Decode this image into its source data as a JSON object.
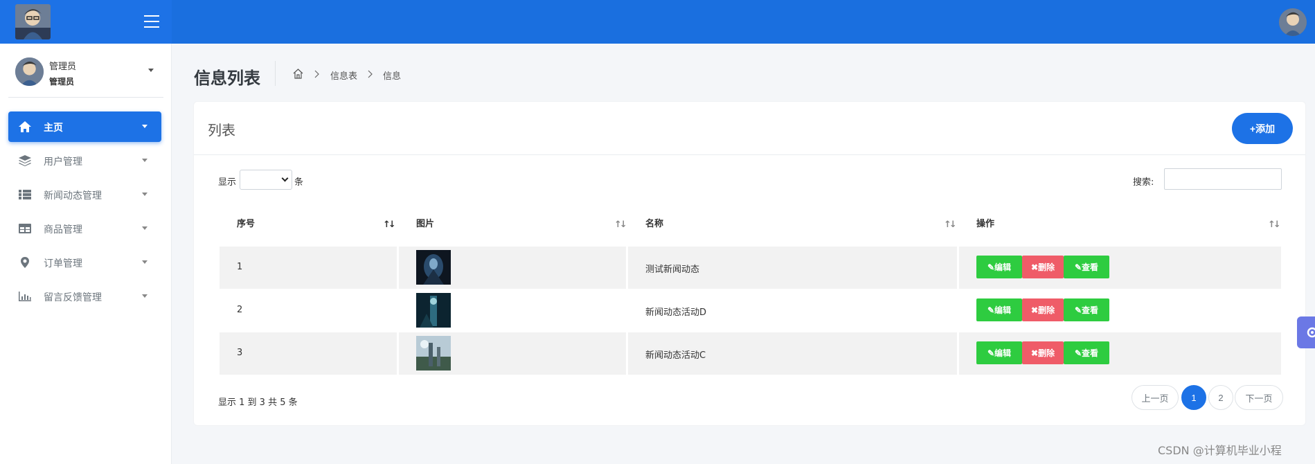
{
  "sidebar": {
    "user": {
      "name": "管理员",
      "role": "管理员"
    },
    "items": [
      {
        "label": "主页",
        "icon": "home-icon",
        "active": true
      },
      {
        "label": "用户管理",
        "icon": "layers-icon",
        "active": false
      },
      {
        "label": "新闻动态管理",
        "icon": "list-icon",
        "active": false
      },
      {
        "label": "商品管理",
        "icon": "table-icon",
        "active": false
      },
      {
        "label": "订单管理",
        "icon": "map-pin-icon",
        "active": false
      },
      {
        "label": "留言反馈管理",
        "icon": "bar-chart-icon",
        "active": false
      }
    ]
  },
  "header": {
    "page_title": "信息列表",
    "breadcrumb": [
      "信息表",
      "信息"
    ]
  },
  "card": {
    "title": "列表",
    "add_label": "+添加",
    "length_prefix": "显示",
    "length_suffix": "条",
    "search_label": "搜索:",
    "search_value": ""
  },
  "table": {
    "columns": [
      "序号",
      "图片",
      "名称",
      "操作"
    ],
    "rows": [
      {
        "index": "1",
        "name": "测试新闻动态"
      },
      {
        "index": "2",
        "name": "新闻动态活动D"
      },
      {
        "index": "3",
        "name": "新闻动态活动C"
      }
    ],
    "actions": {
      "edit": "编辑",
      "delete": "删除",
      "view": "查看"
    }
  },
  "footer": {
    "info": "显示 1 到 3 共 5 条",
    "prev": "上一页",
    "pages": [
      "1",
      "2"
    ],
    "current_page": "1",
    "next": "下一页"
  },
  "watermark": "CSDN @计算机毕业小程",
  "colors": {
    "topbar": "#1a6fdf",
    "primary": "#1d72e6",
    "edit": "#2ecc40",
    "delete": "#ef5c68",
    "settings_tab": "#6b78e5"
  }
}
